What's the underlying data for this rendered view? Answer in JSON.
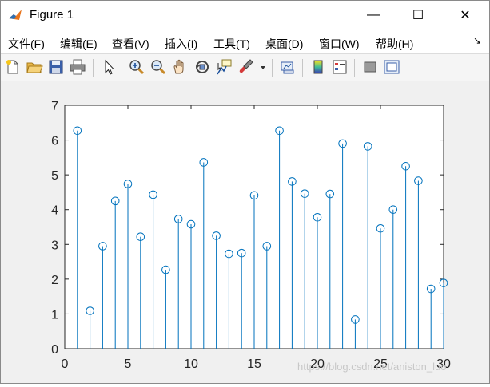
{
  "window": {
    "title": "Figure 1",
    "controls": {
      "minimize": "—",
      "maximize": "☐",
      "close": "✕"
    }
  },
  "menubar": {
    "items": [
      {
        "label": "文件(F)"
      },
      {
        "label": "编辑(E)"
      },
      {
        "label": "查看(V)"
      },
      {
        "label": "插入(I)"
      },
      {
        "label": "工具(T)"
      },
      {
        "label": "桌面(D)"
      },
      {
        "label": "窗口(W)"
      },
      {
        "label": "帮助(H)"
      }
    ],
    "overflow_arrow": "↘"
  },
  "toolbar": {
    "buttons": [
      {
        "icon": "new-figure-icon"
      },
      {
        "icon": "open-file-icon"
      },
      {
        "icon": "save-icon"
      },
      {
        "icon": "print-icon"
      },
      {
        "icon": "select-arrow-icon"
      },
      {
        "icon": "zoom-in-icon"
      },
      {
        "icon": "zoom-out-icon"
      },
      {
        "icon": "pan-hand-icon"
      },
      {
        "icon": "rotate-3d-icon"
      },
      {
        "icon": "data-cursor-icon"
      },
      {
        "icon": "brush-icon"
      },
      {
        "icon": "dropdown-arrow-icon"
      },
      {
        "icon": "link-plot-icon"
      },
      {
        "icon": "colorbar-icon"
      },
      {
        "icon": "legend-icon"
      },
      {
        "icon": "hide-plot-tools-icon"
      },
      {
        "icon": "show-plot-tools-icon"
      }
    ]
  },
  "colors": {
    "stem": "#0072bd",
    "axis": "#262626",
    "background": "#f0f0f0"
  },
  "chart_data": {
    "type": "stem",
    "title": "",
    "xlabel": "",
    "ylabel": "",
    "xlim": [
      0,
      30
    ],
    "ylim": [
      0,
      7
    ],
    "xticks": [
      0,
      5,
      10,
      15,
      20,
      25,
      30
    ],
    "yticks": [
      0,
      1,
      2,
      3,
      4,
      5,
      6,
      7
    ],
    "grid": false,
    "x": [
      1,
      2,
      3,
      4,
      5,
      6,
      7,
      8,
      9,
      10,
      11,
      12,
      13,
      14,
      15,
      16,
      17,
      18,
      19,
      20,
      21,
      22,
      23,
      24,
      25,
      26,
      27,
      28,
      29,
      30
    ],
    "values": [
      6.27,
      1.09,
      2.95,
      4.25,
      4.74,
      3.22,
      4.43,
      2.27,
      3.73,
      3.58,
      5.36,
      3.25,
      2.73,
      2.75,
      4.41,
      2.95,
      6.27,
      4.81,
      4.46,
      3.78,
      4.45,
      5.9,
      0.84,
      5.82,
      3.46,
      4.0,
      5.25,
      4.83,
      1.72,
      1.89
    ]
  },
  "watermark": "https://blog.csdn.net/aniston_luo"
}
